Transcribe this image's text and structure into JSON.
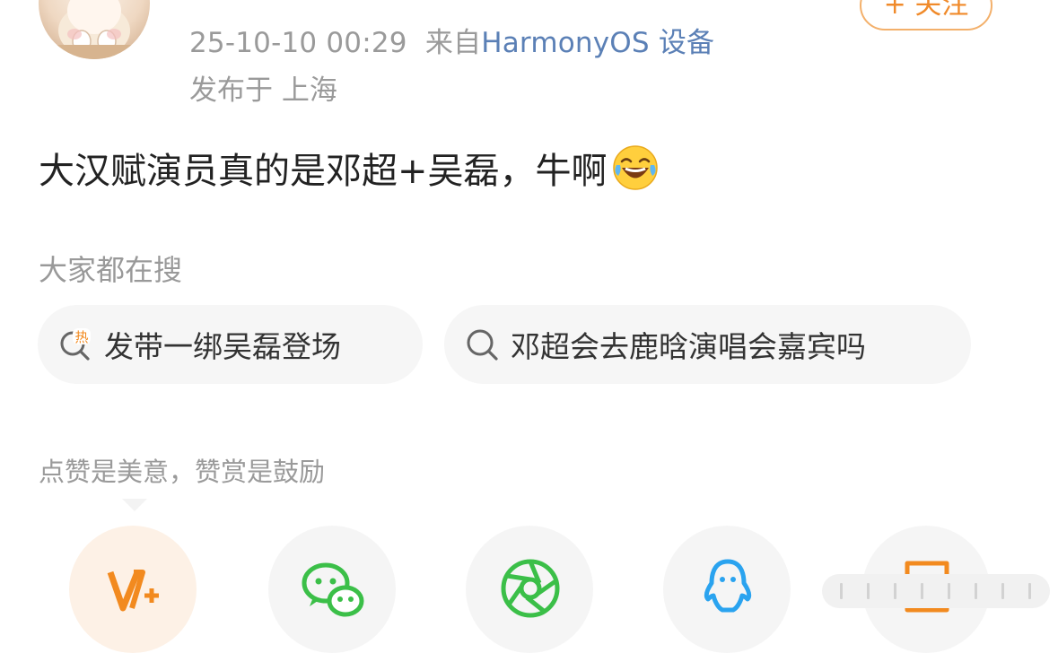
{
  "post": {
    "timestamp": "25-10-10 00:29",
    "source_prefix": "来自",
    "device": "HarmonyOS 设备",
    "location": "发布于 上海",
    "text": "大汉赋演员真的是邓超+吴磊，牛啊",
    "emoji": "laughing-tears-emoji"
  },
  "follow_button": {
    "label": "+ 关注"
  },
  "search": {
    "title": "大家都在搜",
    "chips": [
      {
        "label": "发带一绑吴磊登场",
        "icon": "hot-search-icon"
      },
      {
        "label": "邓超会去鹿晗演唱会嘉宾吗",
        "icon": "search-icon"
      }
    ]
  },
  "reward_tip": "点赞是美意，赞赏是鼓励",
  "share_buttons": [
    {
      "name": "reward",
      "icon": "v-plus-icon",
      "color": "#f28a1f"
    },
    {
      "name": "wechat",
      "icon": "wechat-icon",
      "color": "#3bbf48"
    },
    {
      "name": "moments",
      "icon": "moments-icon",
      "color": "#3bbf48"
    },
    {
      "name": "qq",
      "icon": "qq-icon",
      "color": "#2aa3ef"
    },
    {
      "name": "save",
      "icon": "download-icon",
      "color": "#f28a1f"
    }
  ]
}
